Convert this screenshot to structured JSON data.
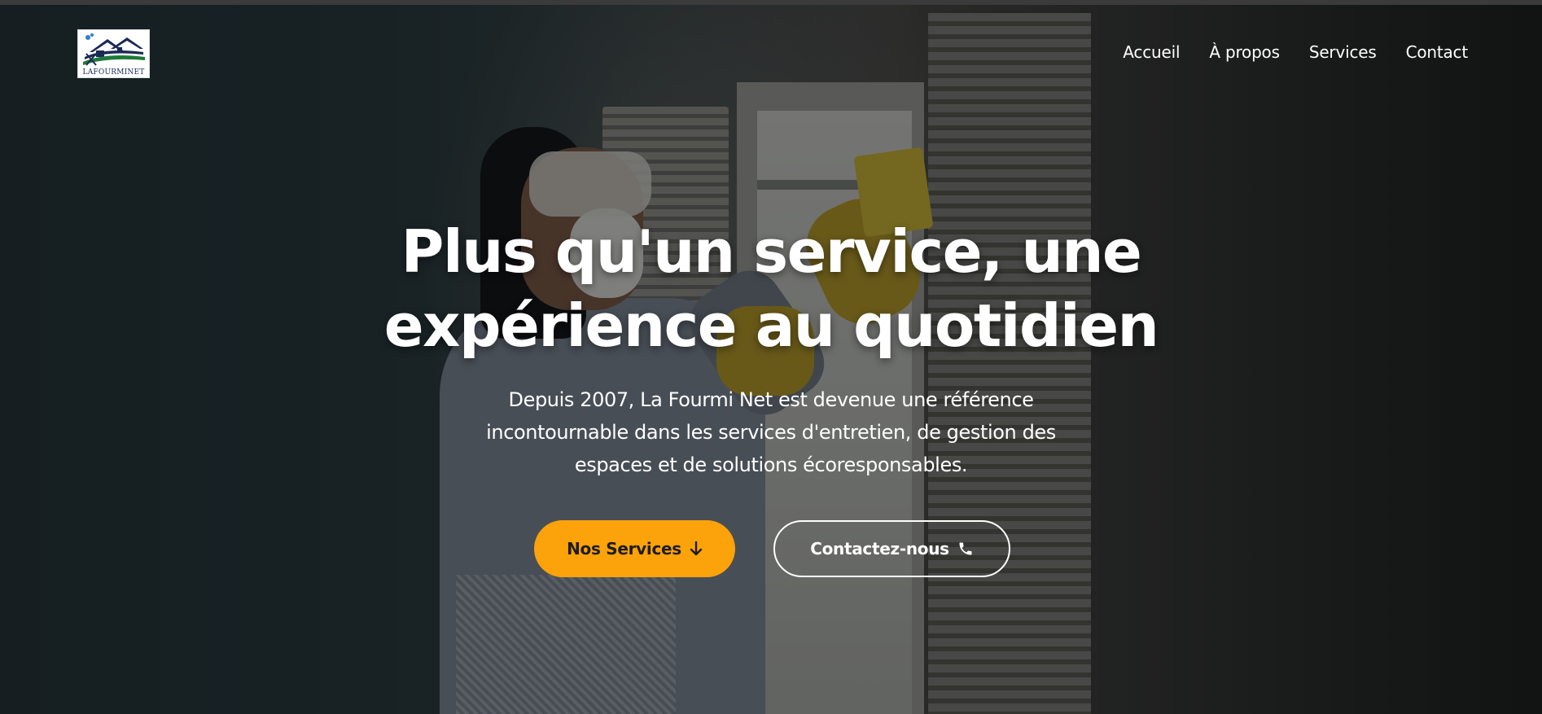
{
  "brand": {
    "logo_text": "LAFOURMINET"
  },
  "nav": {
    "items": [
      {
        "label": "Accueil"
      },
      {
        "label": "À propos"
      },
      {
        "label": "Services"
      },
      {
        "label": "Contact"
      }
    ]
  },
  "hero": {
    "title_line1": "Plus qu'un service, une",
    "title_line2": "expérience au quotidien",
    "subtitle_line1": "Depuis 2007, La Fourmi Net est devenue une référence",
    "subtitle_line2": "incontournable dans les services d'entretien, de gestion des",
    "subtitle_line3": "espaces et de solutions écoresponsables.",
    "primary_button": {
      "label": "Nos Services",
      "icon": "arrow-down-icon"
    },
    "secondary_button": {
      "label": "Contactez-nous",
      "icon": "phone-icon"
    }
  },
  "colors": {
    "accent": "#fca20b",
    "text": "#ffffff",
    "logo_navy": "#1b2a55",
    "logo_green": "#1f7a3a"
  }
}
